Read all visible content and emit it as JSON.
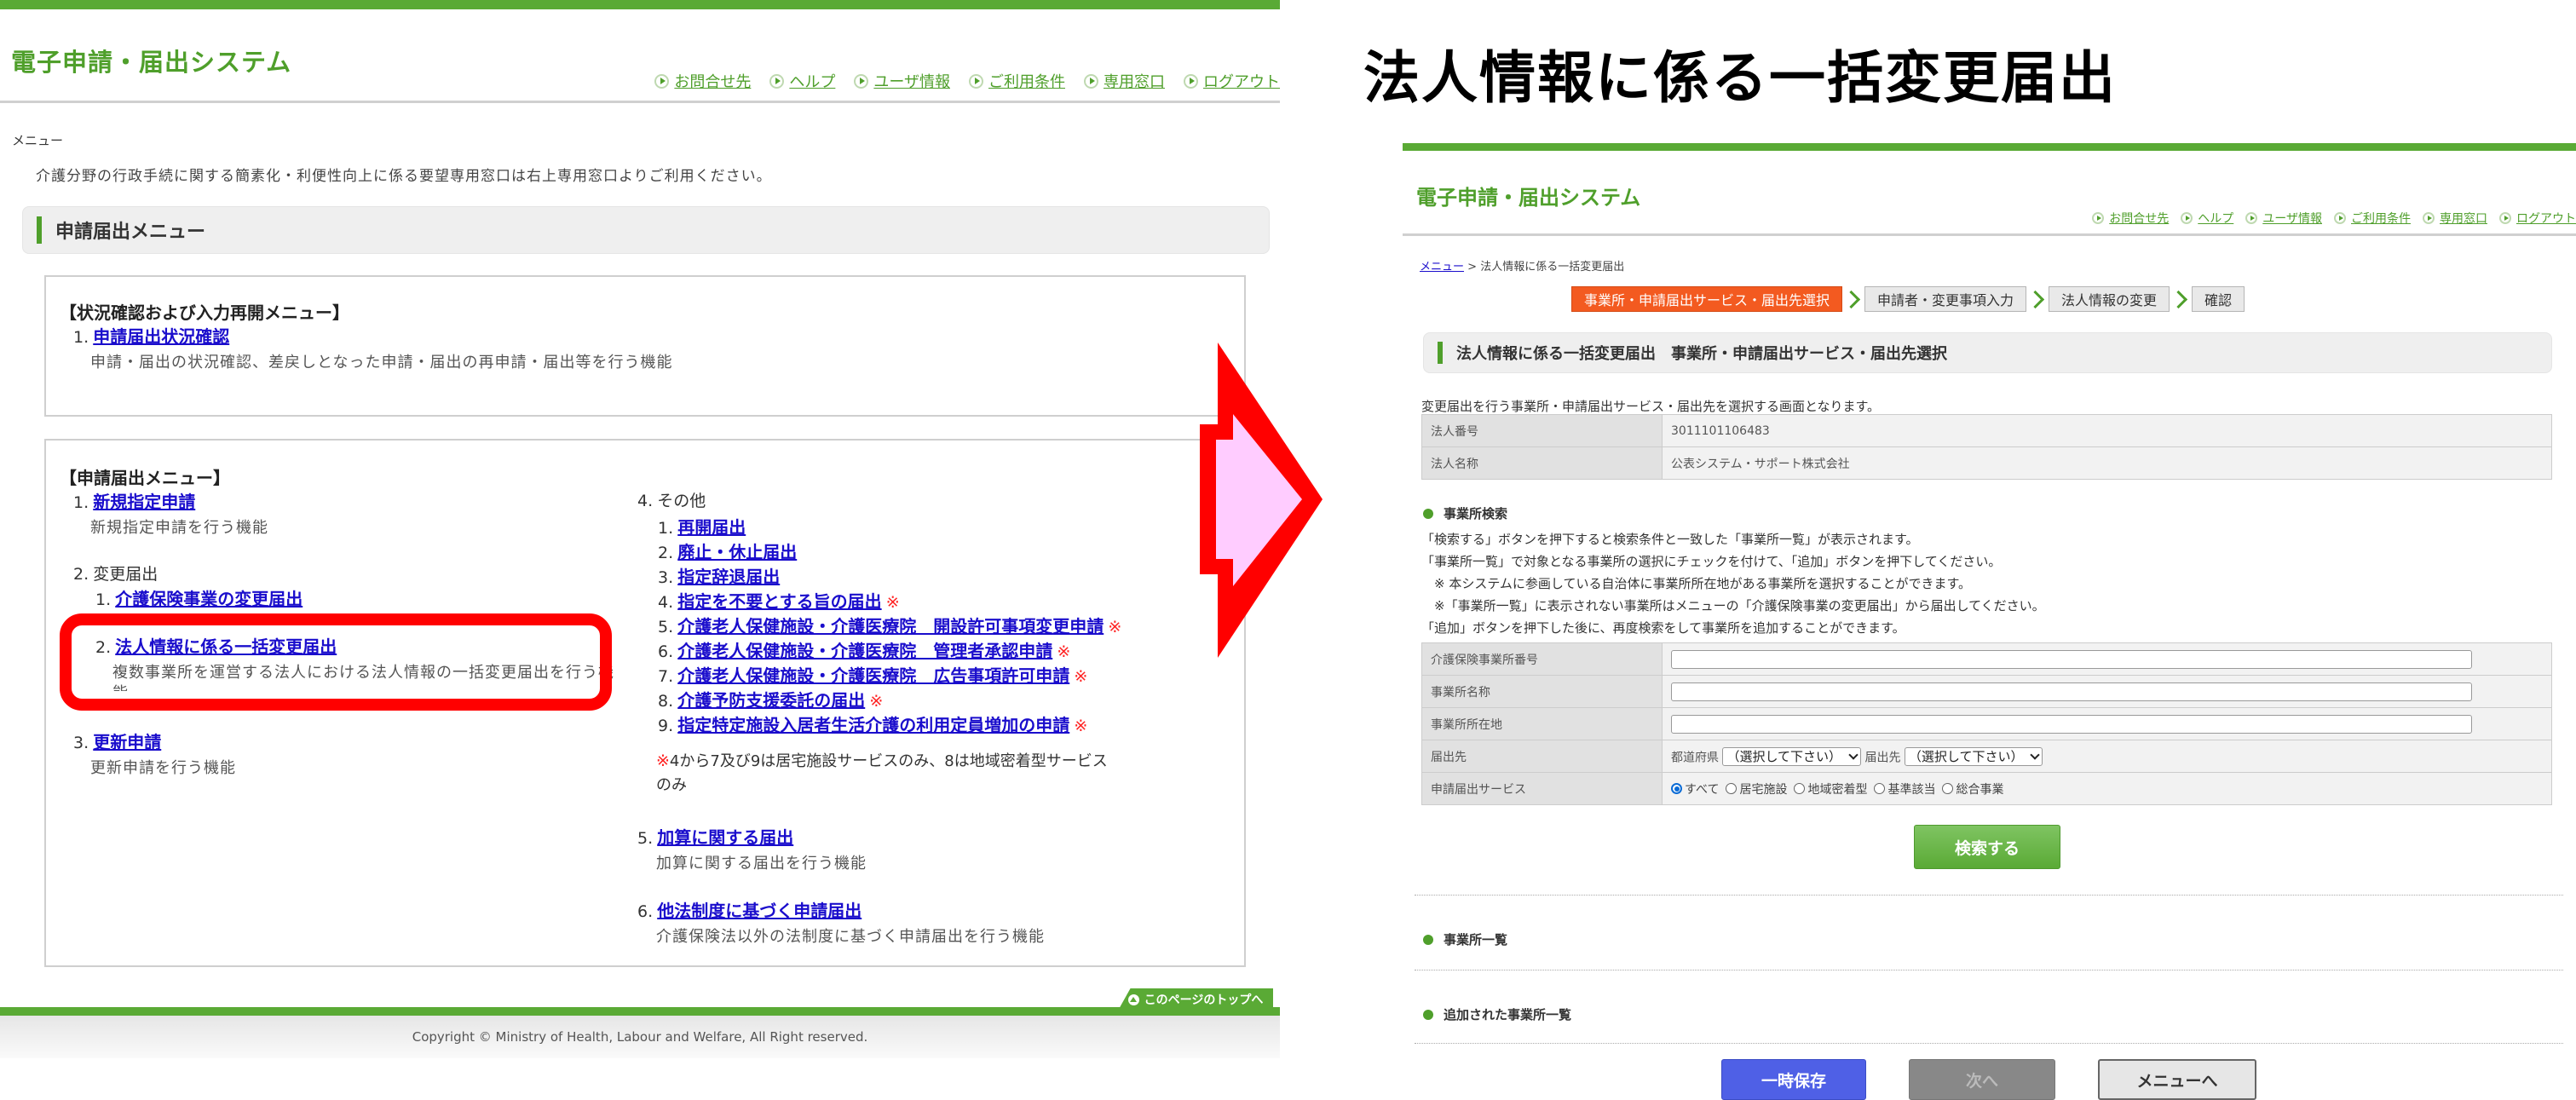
{
  "left": {
    "system_title": "電子申請・届出システム",
    "header_links": [
      "お問合せ先",
      "ヘルプ",
      "ユーザ情報",
      "ご利用条件",
      "専用窓口",
      "ログアウト"
    ],
    "breadcrumb": "メニュー",
    "notice": "介護分野の行政手続に関する簡素化・利便性向上に係る要望専用窓口は右上専用窓口よりご利用ください。",
    "section_title": "申請届出メニュー",
    "status_box": {
      "title": "【状況確認および入力再開メニュー】",
      "items": [
        {
          "num": "1.",
          "label": "申請届出状況確認",
          "desc": "申請・届出の状況確認、差戻しとなった申請・届出の再申請・届出等を行う機能"
        }
      ]
    },
    "menu_box": {
      "title": "【申請届出メニュー】",
      "item1": {
        "num": "1.",
        "label": "新規指定申請",
        "desc": "新規指定申請を行う機能"
      },
      "item2": {
        "num": "2.",
        "label": "変更届出",
        "sub1": {
          "num": "1.",
          "label": "介護保険事業の変更届出"
        },
        "sub2": {
          "num": "2.",
          "label": "法人情報に係る一括変更届出",
          "desc": "複数事業所を運営する法人における法人情報の一括変更届出を行う機",
          "desc_cont": "能"
        }
      },
      "item3": {
        "num": "3.",
        "label": "更新申請",
        "desc": "更新申請を行う機能"
      },
      "item4": {
        "num": "4.",
        "label": "その他",
        "subs": [
          {
            "num": "1.",
            "label": "再開届出",
            "mark": ""
          },
          {
            "num": "2.",
            "label": "廃止・休止届出",
            "mark": ""
          },
          {
            "num": "3.",
            "label": "指定辞退届出",
            "mark": ""
          },
          {
            "num": "4.",
            "label": "指定を不要とする旨の届出",
            "mark": "※"
          },
          {
            "num": "5.",
            "label": "介護老人保健施設・介護医療院　開設許可事項変更申請",
            "mark": "※"
          },
          {
            "num": "6.",
            "label": "介護老人保健施設・介護医療院　管理者承認申請",
            "mark": "※"
          },
          {
            "num": "7.",
            "label": "介護老人保健施設・介護医療院　広告事項許可申請",
            "mark": "※"
          },
          {
            "num": "8.",
            "label": "介護予防支援委託の届出",
            "mark": "※"
          },
          {
            "num": "9.",
            "label": "指定特定施設入居者生活介護の利用定員増加の申請",
            "mark": "※"
          }
        ],
        "note_mark": "※",
        "note": "4から7及び9は居宅施設サービスのみ、8は地域密着型サービス",
        "note_cont": "のみ"
      },
      "item5": {
        "num": "5.",
        "label": "加算に関する届出",
        "desc": "加算に関する届出を行う機能"
      },
      "item6": {
        "num": "6.",
        "label": "他法制度に基づく申請届出",
        "desc": "介護保険法以外の法制度に基づく申請届出を行う機能"
      }
    },
    "page_top": "このページのトップへ",
    "copyright": "Copyright © Ministry of Health, Labour and Welfare, All Right reserved."
  },
  "big_title": "法人情報に係る一括変更届出",
  "right": {
    "system_title": "電子申請・届出システム",
    "header_links": [
      "お問合せ先",
      "ヘルプ",
      "ユーザ情報",
      "ご利用条件",
      "専用窓口",
      "ログアウト"
    ],
    "breadcrumb": {
      "link": "メニュー",
      "sep": " > ",
      "current": "法人情報に係る一括変更届出"
    },
    "steps": [
      {
        "label": "事業所・申請届出サービス・届出先選択",
        "active": true
      },
      {
        "label": "申請者・変更事項入力",
        "active": false
      },
      {
        "label": "法人情報の変更",
        "active": false
      },
      {
        "label": "確認",
        "active": false
      }
    ],
    "section_title": "法人情報に係る一括変更届出　事業所・申請届出サービス・届出先選択",
    "intro": "変更届出を行う事業所・申請届出サービス・届出先を選択する画面となります。",
    "corp": [
      {
        "label": "法人番号",
        "value": "3011101106483"
      },
      {
        "label": "法人名称",
        "value": "公表システム・サポート株式会社"
      }
    ],
    "search_heading": "事業所検索",
    "guide": [
      "「検索する」ボタンを押下すると検索条件と一致した「事業所一覧」が表示されます。",
      "「事業所一覧」で対象となる事業所の選択にチェックを付けて、「追加」ボタンを押下してください。",
      "　※ 本システムに参画している自治体に事業所所在地がある事業所を選択することができます。",
      "　※「事業所一覧」に表示されない事業所はメニューの「介護保険事業の変更届出」から届出してください。",
      "「追加」ボタンを押下した後に、再度検索をして事業所を追加することができます。"
    ],
    "search_form": {
      "office_number_label": "介護保険事業所番号",
      "office_number_value": "",
      "office_name_label": "事業所名称",
      "office_name_value": "",
      "office_address_label": "事業所所在地",
      "office_address_value": "",
      "destination_label": "届出先",
      "prefecture_label": "都道府県",
      "prefecture_value": "（選択して下さい）",
      "destination_sub_label": "届出先",
      "destination_value": "（選択して下さい）",
      "service_label": "申請届出サービス",
      "service_options": [
        {
          "label": "すべて",
          "checked": true
        },
        {
          "label": "居宅施設",
          "checked": false
        },
        {
          "label": "地域密着型",
          "checked": false
        },
        {
          "label": "基準該当",
          "checked": false
        },
        {
          "label": "総合事業",
          "checked": false
        }
      ]
    },
    "search_button": "検索する",
    "office_list_heading": "事業所一覧",
    "added_list_heading": "追加された事業所一覧",
    "buttons": {
      "save": "一時保存",
      "next": "次へ",
      "menu": "メニューへ"
    }
  },
  "colors": {
    "brand_green": "#5aaa35",
    "active_step": "#f35a20",
    "link_blue": "#1a0dcc",
    "highlight_red": "#ff0000",
    "arrow_fill": "#ffccff",
    "save_blue": "#4f60e6"
  }
}
